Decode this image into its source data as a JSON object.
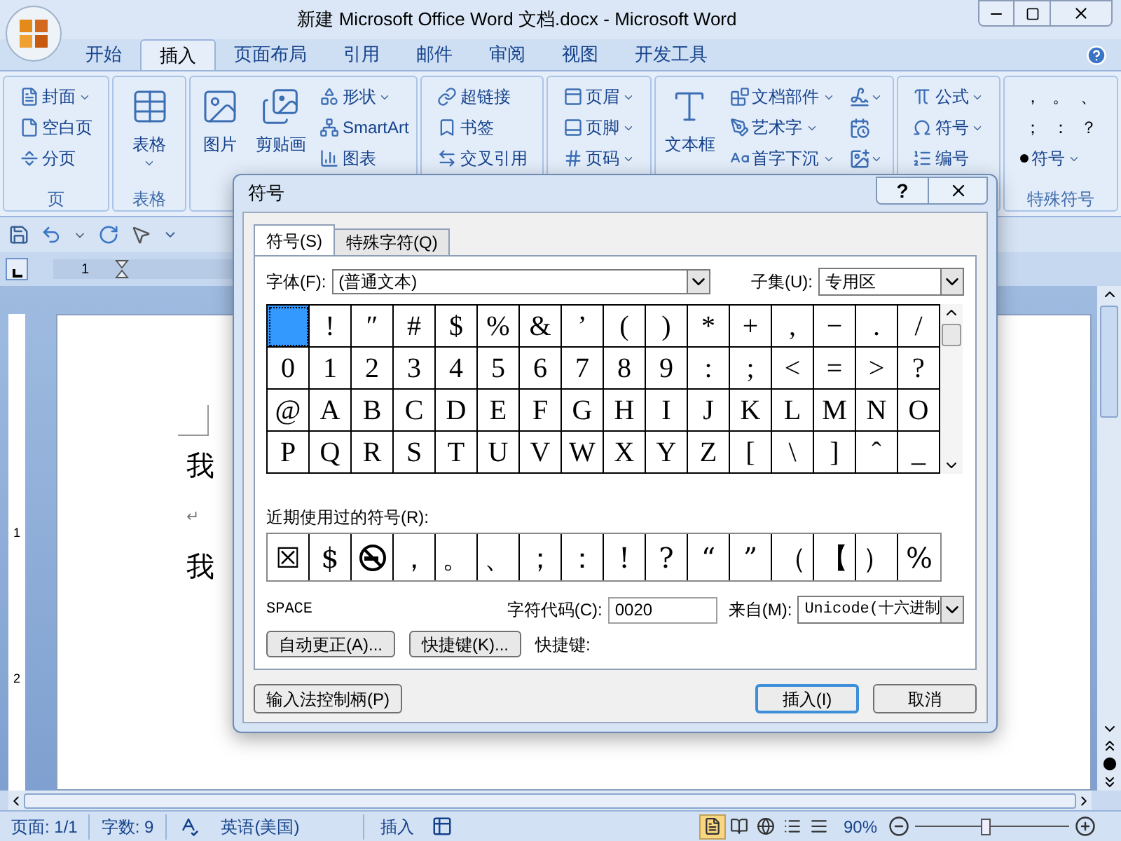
{
  "window": {
    "title": "新建 Microsoft Office Word 文档.docx - Microsoft Word"
  },
  "tabs": [
    {
      "label": "开始",
      "selected": false
    },
    {
      "label": "插入",
      "selected": true
    },
    {
      "label": "页面布局",
      "selected": false
    },
    {
      "label": "引用",
      "selected": false
    },
    {
      "label": "邮件",
      "selected": false
    },
    {
      "label": "审阅",
      "selected": false
    },
    {
      "label": "视图",
      "selected": false
    },
    {
      "label": "开发工具",
      "selected": false
    }
  ],
  "ribbon": {
    "groups": [
      {
        "label": "页",
        "items": [
          {
            "kind": "small",
            "label": "封面",
            "dropdown": true
          },
          {
            "kind": "small",
            "label": "空白页",
            "dropdown": false
          },
          {
            "kind": "small",
            "label": "分页",
            "dropdown": false
          }
        ]
      },
      {
        "label": "表格",
        "items": [
          {
            "kind": "large",
            "label": "表格",
            "dropdown": true
          }
        ]
      },
      {
        "items": [
          {
            "kind": "large",
            "label": "图片",
            "dropdown": false
          },
          {
            "kind": "large",
            "label": "剪贴画",
            "dropdown": false
          },
          {
            "kind": "small",
            "label": "形状",
            "dropdown": true
          },
          {
            "kind": "small",
            "label": "SmartArt",
            "dropdown": false
          },
          {
            "kind": "small",
            "label": "图表",
            "dropdown": false
          }
        ]
      },
      {
        "items": [
          {
            "kind": "small",
            "label": "超链接",
            "dropdown": false
          },
          {
            "kind": "small",
            "label": "书签",
            "dropdown": false
          },
          {
            "kind": "small",
            "label": "交叉引用",
            "dropdown": false
          }
        ]
      },
      {
        "items": [
          {
            "kind": "small",
            "label": "页眉",
            "dropdown": true
          },
          {
            "kind": "small",
            "label": "页脚",
            "dropdown": true
          },
          {
            "kind": "small",
            "label": "页码",
            "dropdown": true
          }
        ]
      },
      {
        "items": [
          {
            "kind": "large",
            "label": "文本框",
            "dropdown": false
          },
          {
            "kind": "small",
            "label": "文档部件",
            "dropdown": true
          },
          {
            "kind": "small",
            "label": "艺术字",
            "dropdown": true
          },
          {
            "kind": "small",
            "label": "首字下沉",
            "dropdown": true
          },
          {
            "kind": "icon",
            "dropdown": true
          },
          {
            "kind": "icon",
            "dropdown": false
          },
          {
            "kind": "icon",
            "dropdown": true
          }
        ]
      },
      {
        "items": [
          {
            "kind": "small",
            "label": "公式",
            "dropdown": true
          },
          {
            "kind": "small",
            "label": "符号",
            "dropdown": true
          },
          {
            "kind": "small",
            "label": "编号",
            "dropdown": false
          }
        ]
      },
      {
        "label": "特殊符号",
        "items": [
          {
            "kind": "char",
            "label": "，"
          },
          {
            "kind": "char",
            "label": "。"
          },
          {
            "kind": "char",
            "label": "、"
          },
          {
            "kind": "char",
            "label": "；"
          },
          {
            "kind": "char",
            "label": "："
          },
          {
            "kind": "char",
            "label": "？"
          },
          {
            "kind": "small",
            "label": "符号",
            "dropdown": true
          }
        ]
      }
    ]
  },
  "ruler": {
    "horizontal": [
      "1"
    ],
    "vertical": [
      "1",
      "2"
    ]
  },
  "document": {
    "paragraphs": [
      {
        "kind": "text",
        "text": "我"
      },
      {
        "kind": "mark",
        "text": "↵"
      },
      {
        "kind": "text",
        "text": "我"
      }
    ]
  },
  "dialog": {
    "title": "符号",
    "help": "?",
    "tabs": [
      {
        "label": "符号(S)",
        "selected": true
      },
      {
        "label": "特殊字符(Q)",
        "selected": false
      }
    ],
    "font": {
      "label": "字体(F):",
      "value": "(普通文本)"
    },
    "subset": {
      "label": "子集(U):",
      "value": "专用区"
    },
    "symbols": [
      [
        {
          "selected": true
        },
        {
          "c": "!",
          "selected": false
        },
        {
          "c": "″",
          "selected": false
        },
        {
          "c": "#",
          "selected": false
        },
        {
          "c": "$",
          "selected": false
        },
        {
          "c": "%",
          "selected": false
        },
        {
          "c": "&",
          "selected": false
        },
        {
          "c": "’",
          "selected": false
        },
        {
          "c": "(",
          "selected": false
        },
        {
          "c": ")",
          "selected": false
        },
        {
          "c": "*",
          "selected": false
        },
        {
          "c": "+",
          "selected": false
        },
        {
          "c": ",",
          "selected": false
        },
        {
          "c": "−",
          "selected": false
        },
        {
          "c": ".",
          "selected": false
        },
        {
          "c": "/",
          "selected": false
        }
      ],
      [
        {
          "c": "0",
          "selected": false
        },
        {
          "c": "1",
          "selected": false
        },
        {
          "c": "2",
          "selected": false
        },
        {
          "c": "3",
          "selected": false
        },
        {
          "c": "4",
          "selected": false
        },
        {
          "c": "5",
          "selected": false
        },
        {
          "c": "6",
          "selected": false
        },
        {
          "c": "7",
          "selected": false
        },
        {
          "c": "8",
          "selected": false
        },
        {
          "c": "9",
          "selected": false
        },
        {
          "c": ":",
          "selected": false
        },
        {
          "c": ";",
          "selected": false
        },
        {
          "c": "<",
          "selected": false
        },
        {
          "c": "=",
          "selected": false
        },
        {
          "c": ">",
          "selected": false
        },
        {
          "c": "?",
          "selected": false
        }
      ],
      [
        {
          "c": "@",
          "selected": false
        },
        {
          "c": "A",
          "selected": false
        },
        {
          "c": "B",
          "selected": false
        },
        {
          "c": "C",
          "selected": false
        },
        {
          "c": "D",
          "selected": false
        },
        {
          "c": "E",
          "selected": false
        },
        {
          "c": "F",
          "selected": false
        },
        {
          "c": "G",
          "selected": false
        },
        {
          "c": "H",
          "selected": false
        },
        {
          "c": "I",
          "selected": false
        },
        {
          "c": "J",
          "selected": false
        },
        {
          "c": "K",
          "selected": false
        },
        {
          "c": "L",
          "selected": false
        },
        {
          "c": "M",
          "selected": false
        },
        {
          "c": "N",
          "selected": false
        },
        {
          "c": "O",
          "selected": false
        }
      ],
      [
        {
          "c": "P",
          "selected": false
        },
        {
          "c": "Q",
          "selected": false
        },
        {
          "c": "R",
          "selected": false
        },
        {
          "c": "S",
          "selected": false
        },
        {
          "c": "T",
          "selected": false
        },
        {
          "c": "U",
          "selected": false
        },
        {
          "c": "V",
          "selected": false
        },
        {
          "c": "W",
          "selected": false
        },
        {
          "c": "X",
          "selected": false
        },
        {
          "c": "Y",
          "selected": false
        },
        {
          "c": "Z",
          "selected": false
        },
        {
          "c": "[",
          "selected": false
        },
        {
          "c": "\\",
          "selected": false
        },
        {
          "c": "]",
          "selected": false
        },
        {
          "c": "ˆ",
          "selected": false
        },
        {
          "c": "_",
          "selected": false
        }
      ]
    ],
    "recent": {
      "label": "近期使用过的符号(R):",
      "items": [
        {
          "kind": "char",
          "c": "☒"
        },
        {
          "kind": "char",
          "c": "$"
        },
        {
          "kind": "glyph"
        },
        {
          "kind": "char",
          "c": "，"
        },
        {
          "kind": "char",
          "c": "。"
        },
        {
          "kind": "char",
          "c": "、"
        },
        {
          "kind": "char",
          "c": "；"
        },
        {
          "kind": "char",
          "c": "："
        },
        {
          "kind": "char",
          "c": "!"
        },
        {
          "kind": "char",
          "c": "?"
        },
        {
          "kind": "char",
          "c": "“"
        },
        {
          "kind": "char",
          "c": "”"
        },
        {
          "kind": "char",
          "c": "（"
        },
        {
          "kind": "char",
          "c": "【"
        },
        {
          "kind": "char",
          "c": "）"
        },
        {
          "kind": "char",
          "c": "%"
        }
      ]
    },
    "char_name": "SPACE",
    "code": {
      "label": "字符代码(C):",
      "value": "0020"
    },
    "from": {
      "label": "来自(M):",
      "value": "Unicode(十六进制"
    },
    "buttons": [
      "自动更正(A)...",
      "快捷键(K)..."
    ],
    "shortcut_label": "快捷键:",
    "footer_buttons": [
      {
        "label": "输入法控制柄(P)",
        "default": false
      },
      {
        "label": "插入(I)",
        "default": true
      },
      {
        "label": "取消",
        "default": false
      }
    ]
  },
  "status": {
    "page": "页面: 1/1",
    "words": "字数: 9",
    "language": "英语(美国)",
    "mode": "插入",
    "views": [
      {
        "selected": true
      },
      {
        "selected": false
      },
      {
        "selected": false
      },
      {
        "selected": false
      },
      {
        "selected": false
      }
    ],
    "zoom": {
      "reading": "90%",
      "level": 0.45
    }
  }
}
